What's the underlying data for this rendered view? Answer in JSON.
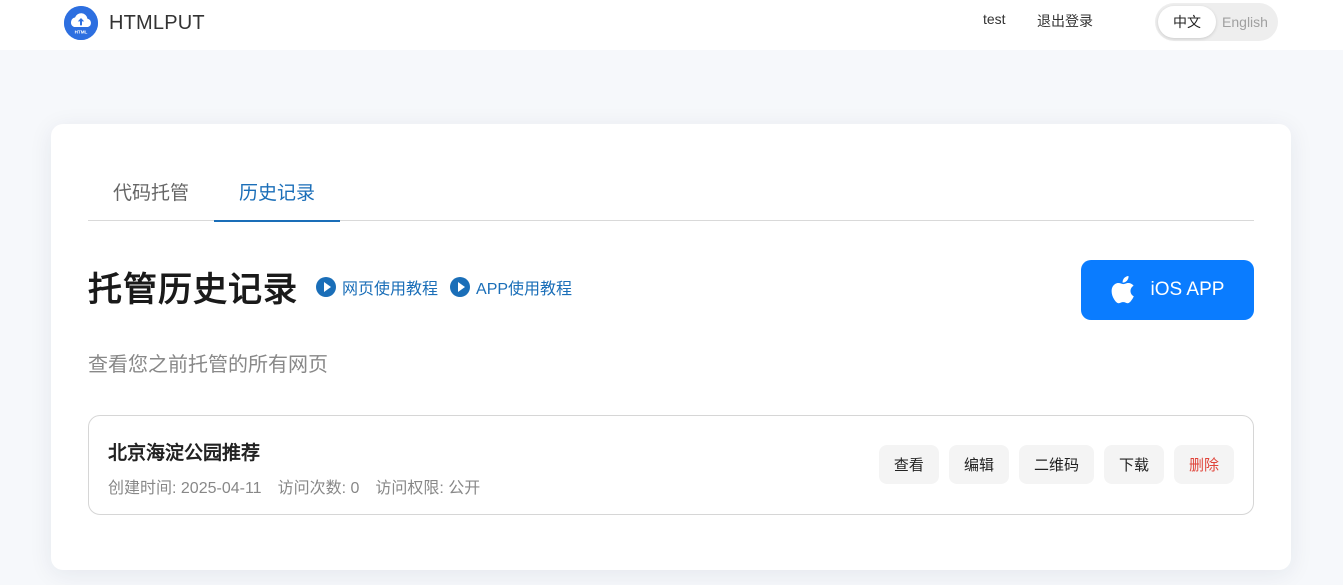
{
  "header": {
    "brand": "HTMLPUT",
    "logo_text": "HTML",
    "user": "test",
    "logout": "退出登录",
    "lang": {
      "zh": "中文",
      "en": "English",
      "active": "zh"
    }
  },
  "tabs": [
    {
      "label": "代码托管",
      "active": false
    },
    {
      "label": "历史记录",
      "active": true
    }
  ],
  "main": {
    "title": "托管历史记录",
    "web_tutorial": "网页使用教程",
    "app_tutorial": "APP使用教程",
    "ios_button": "iOS APP",
    "subtitle": "查看您之前托管的所有网页"
  },
  "records": [
    {
      "title": "北京海淀公园推荐",
      "created": "创建时间: 2025-04-11",
      "visits": "访问次数: 0",
      "access": "访问权限: 公开",
      "actions": {
        "view": "查看",
        "edit": "编辑",
        "qr": "二维码",
        "download": "下载",
        "delete": "删除"
      }
    }
  ],
  "colors": {
    "accent": "#1a6eb8",
    "ios_button": "#0a7cff",
    "danger": "#e0443a",
    "logo": "#2d6fe0"
  }
}
